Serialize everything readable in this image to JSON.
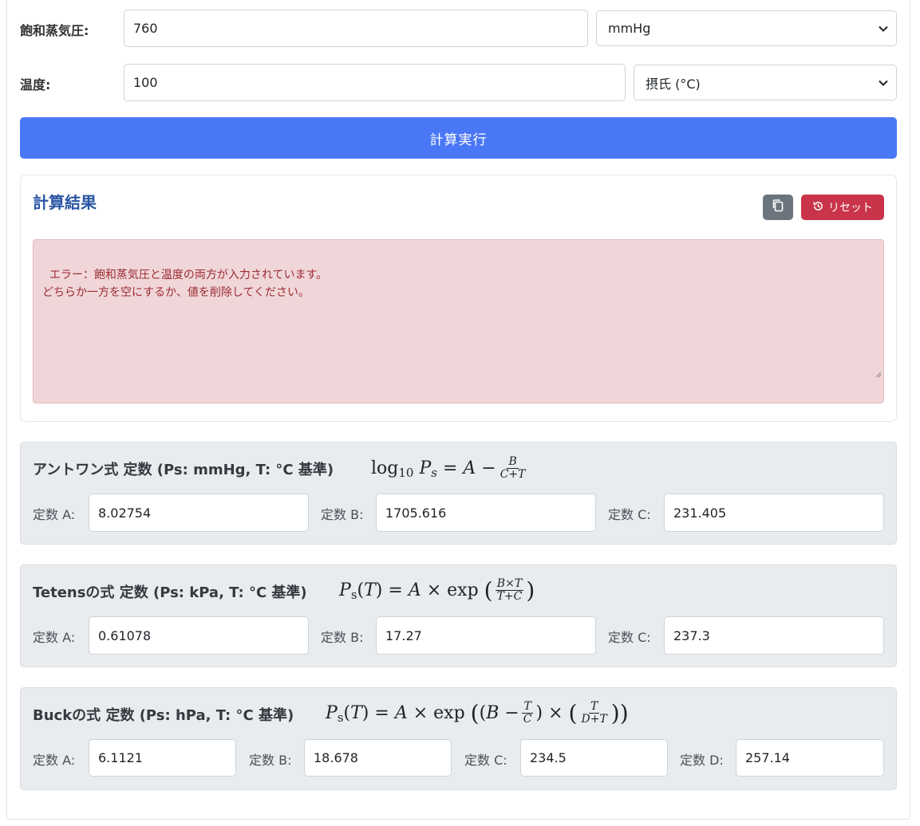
{
  "form": {
    "pressure_label": "飽和蒸気圧:",
    "pressure_value": "760",
    "pressure_unit": "mmHg",
    "temp_label": "温度:",
    "temp_value": "100",
    "temp_unit": "摂氏 (°C)",
    "calc_button": "計算実行"
  },
  "result": {
    "title": "計算結果",
    "reset_label": "リセット",
    "error_text": "エラー：飽和蒸気圧と温度の両方が入力されています。\nどちらか一方を空にするか、値を削除してください。"
  },
  "antoine": {
    "title": "アントワン式 定数 (Ps: mmHg, T: °C 基準)",
    "a_label": "定数 A:",
    "a_value": "8.02754",
    "b_label": "定数 B:",
    "b_value": "1705.616",
    "c_label": "定数 C:",
    "c_value": "231.405"
  },
  "tetens": {
    "title": "Tetensの式 定数 (Ps: kPa, T: °C 基準)",
    "a_label": "定数 A:",
    "a_value": "0.61078",
    "b_label": "定数 B:",
    "b_value": "17.27",
    "c_label": "定数 C:",
    "c_value": "237.3"
  },
  "buck": {
    "title": "Buckの式 定数 (Ps: hPa, T: °C 基準)",
    "a_label": "定数 A:",
    "a_value": "6.1121",
    "b_label": "定数 B:",
    "b_value": "18.678",
    "c_label": "定数 C:",
    "c_value": "234.5",
    "d_label": "定数 D:",
    "d_value": "257.14"
  },
  "colors": {
    "primary": "#4a77f6",
    "danger": "#c9344a",
    "secondary": "#6c757d",
    "title_blue": "#2a56a4"
  },
  "icons": {
    "copy": "copy-icon",
    "reset": "history-icon",
    "dropdown": "chevron-down-icon"
  }
}
